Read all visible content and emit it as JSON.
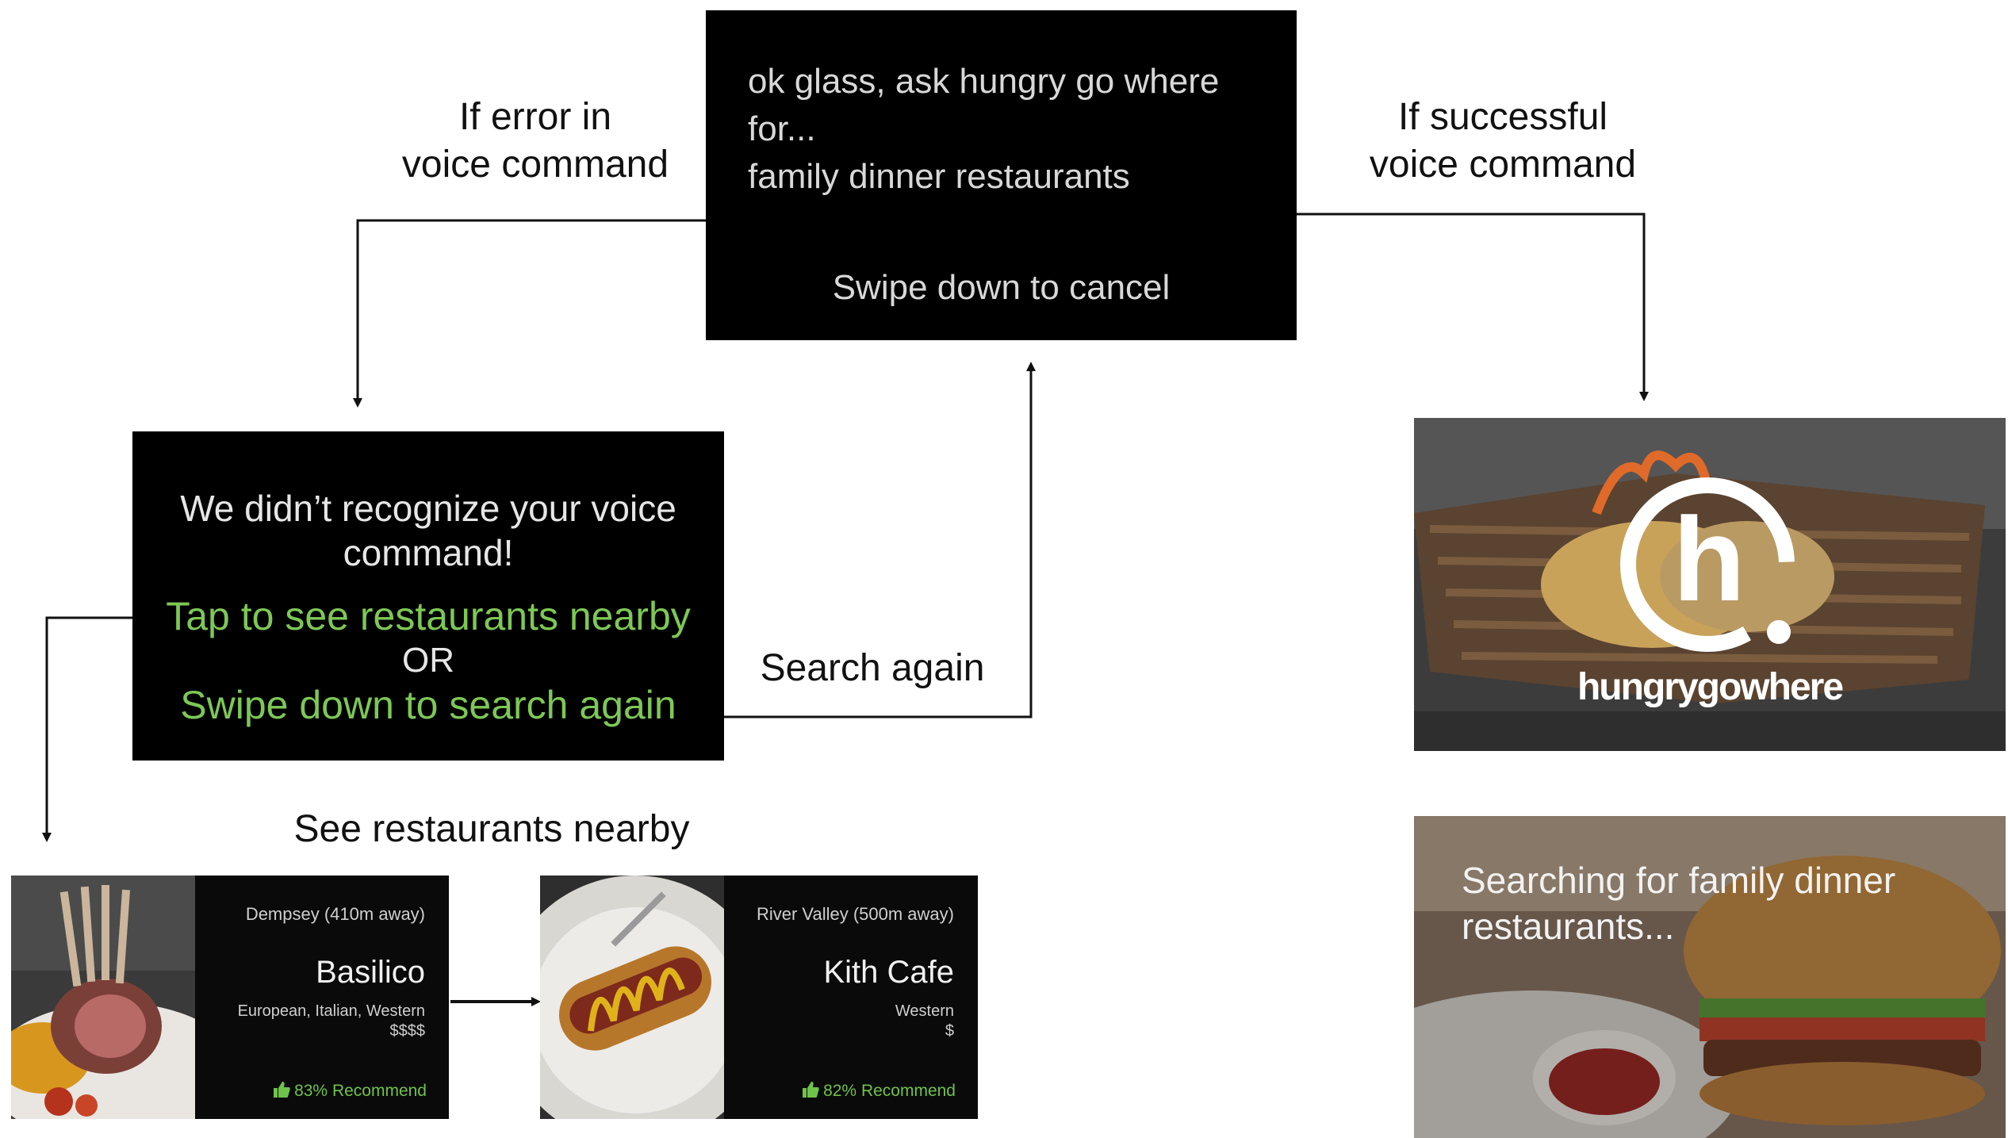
{
  "voice_card": {
    "line1": "ok glass, ask hungry go where for...",
    "line2": "family dinner restaurants",
    "cancel": "Swipe down to cancel"
  },
  "labels": {
    "error": [
      "If error in",
      "voice command"
    ],
    "success": [
      "If successful",
      "voice command"
    ],
    "search_again": "Search again",
    "see_nearby": "See restaurants nearby"
  },
  "error_card": {
    "message": "We didn’t recognize your voice command!",
    "option1": "Tap to see restaurants nearby",
    "or": "OR",
    "option2": "Swipe down to search again"
  },
  "restaurants": [
    {
      "location": "Dempsey (410m away)",
      "name": "Basilico",
      "cuisine": "European, Italian, Western",
      "price": "$$$$",
      "recommend": "83% Recommend"
    },
    {
      "location": "River Valley (500m away)",
      "name": "Kith Cafe",
      "cuisine": "Western",
      "price": "$",
      "recommend": "82% Recommend"
    }
  ],
  "splash": {
    "brand": "hungrygowhere"
  },
  "searching": {
    "text": "Searching for family dinner restaurants..."
  },
  "colors": {
    "accent_green": "#7dc855",
    "card_bg": "#000000"
  }
}
